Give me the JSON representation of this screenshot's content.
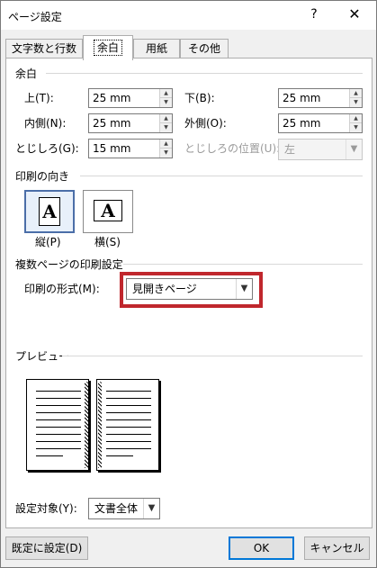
{
  "window": {
    "title": "ページ設定",
    "help_glyph": "?",
    "close_glyph": "✕"
  },
  "tabs": [
    {
      "label": "文字数と行数",
      "active": false
    },
    {
      "label": "余白",
      "active": true
    },
    {
      "label": "用紙",
      "active": false
    },
    {
      "label": "その他",
      "active": false
    }
  ],
  "margins": {
    "header": "余白",
    "top_label": "上(T):",
    "top_value": "25 mm",
    "bottom_label": "下(B):",
    "bottom_value": "25 mm",
    "inside_label": "内側(N):",
    "inside_value": "25 mm",
    "outside_label": "外側(O):",
    "outside_value": "25 mm",
    "gutter_label": "とじしろ(G):",
    "gutter_value": "15 mm",
    "gutter_pos_label": "とじしろの位置(U):",
    "gutter_pos_value": "左"
  },
  "orientation": {
    "header": "印刷の向き",
    "portrait_label": "縦(P)",
    "landscape_label": "横(S)",
    "glyph": "A",
    "selected": "portrait"
  },
  "pages": {
    "header": "複数ページの印刷設定",
    "format_label": "印刷の形式(M):",
    "format_value": "見開きページ"
  },
  "preview": {
    "header": "プレビュー"
  },
  "apply": {
    "label": "設定対象(Y):",
    "value": "文書全体"
  },
  "footer": {
    "default_button": "既定に設定(D)",
    "ok_button": "OK",
    "cancel_button": "キャンセル"
  },
  "colors": {
    "highlight": "#c0272d",
    "accent": "#0078d7"
  }
}
